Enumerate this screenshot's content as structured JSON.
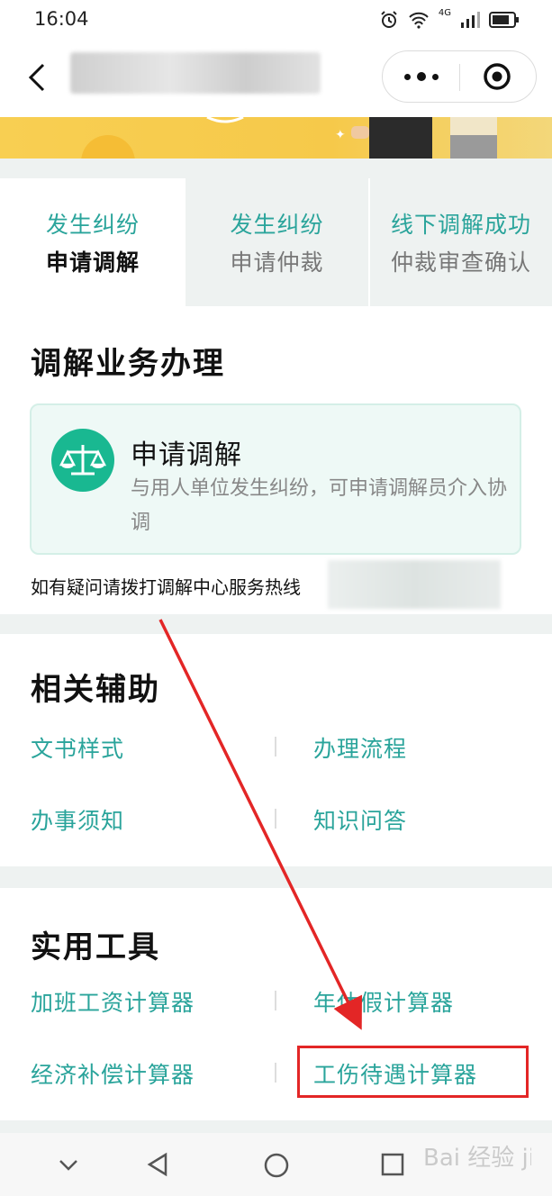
{
  "status_bar": {
    "time": "16:04",
    "network": "4G"
  },
  "tabs": [
    {
      "line1": "发生纠纷",
      "line2": "申请调解"
    },
    {
      "line1": "发生纠纷",
      "line2": "申请仲裁"
    },
    {
      "line1": "线下调解成功",
      "line2": "仲裁审查确认"
    }
  ],
  "mediation": {
    "heading": "调解业务办理",
    "card_title": "申请调解",
    "card_desc": "与用人单位发生纠纷，可申请调解员介入协调",
    "hotline_text": "如有疑问请拨打调解中心服务热线"
  },
  "aux": {
    "heading": "相关辅助",
    "links": [
      "文书样式",
      "办理流程",
      "办事须知",
      "知识问答"
    ]
  },
  "tools": {
    "heading": "实用工具",
    "links": [
      "加班工资计算器",
      "年休假计算器",
      "经济补偿计算器",
      "工伤待遇计算器"
    ]
  },
  "colors": {
    "accent": "#2aa49b",
    "icon_bg": "#19b891",
    "highlight": "#e32626",
    "banner": "#f8cf52"
  },
  "icons": [
    "back-icon",
    "more-icon",
    "close-miniprogram-icon",
    "scale-icon",
    "alarm-icon",
    "wifi-icon",
    "signal-icon",
    "battery-icon",
    "nav-down-icon",
    "nav-back-icon",
    "nav-home-icon",
    "nav-recent-icon"
  ],
  "watermark": "Bai 经验 jingyan.baidu.com"
}
